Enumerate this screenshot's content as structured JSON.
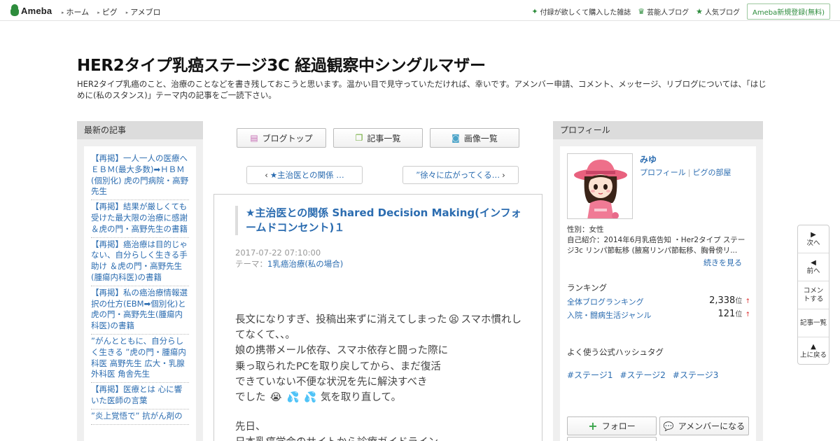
{
  "topbar": {
    "logo": "Ameba",
    "nav": [
      "ホーム",
      "ピグ",
      "アメブロ"
    ],
    "links": [
      {
        "icon": "sparkle-icon",
        "label": "付録が欲しくて購入した雑誌"
      },
      {
        "icon": "crown-icon",
        "label": "芸能人ブログ"
      },
      {
        "icon": "star-icon",
        "label": "人気ブログ"
      }
    ],
    "register": "Ameba新規登録(無料)"
  },
  "header": {
    "title": "HER2タイプ乳癌ステージ3C 経過観察中シングルマザー",
    "description": "HER2タイプ乳癌のこと、治療のことなどを書き残しておこうと思います。温かい目で見守っていただければ、幸いです。アメンバー申請、コメント、メッセージ、リブログについては、「はじめに(私のスタンス)」テーマ内の記事をご一読下さい。"
  },
  "left": {
    "heading": "最新の記事",
    "items": [
      "【再掲】一人一人の医療へ ＥＢＭ(最大多数)➡ＨＢＭ(個別化) 虎の門病院・高野先生",
      "【再掲】結果が厳しくても受けた最大限の治療に感謝 ＆虎の門・高野先生の書籍",
      "【再掲】癌治療は目的じゃない、自分らしく生きる手助け ＆虎の門・高野先生(腫瘍内科医)の書籍",
      "【再掲】私の癌治療情報選択の仕方(EBM➡個別化)と虎の門・高野先生(腫瘍内科医)の書籍",
      "”がんとともに、自分らしく生きる ”虎の門・腫瘍内科医 高野先生 広大・乳腺外科医 角舎先生",
      "【再掲】医療とは 心に響いた医師の言葉",
      "”炎上覚悟で” 抗がん剤の"
    ]
  },
  "nav_buttons": [
    {
      "icon": "document-icon",
      "label": "ブログトップ"
    },
    {
      "icon": "copy-icon",
      "label": "記事一覧"
    },
    {
      "icon": "camera-icon",
      "label": "画像一覧"
    }
  ],
  "pager": {
    "prev": "★主治医との関係 …",
    "next": "”徐々に広がってくる…"
  },
  "article": {
    "title": "★主治医との関係 Shared Decision Making(インフォームドコンセント)１",
    "date": "2017-07-22 07:10:00",
    "theme_label": "テーマ：",
    "theme": "1乳癌治療(私の場合)",
    "line1a": "長文になりすぎ、投稿出来ずに消えてしまった",
    "emoji1": "😫",
    "line1b": "スマホ慣れしてなくて、、。",
    "line2": "娘の携帯メール依存、スマホ依存と闘った際に",
    "line3": "乗っ取られたPCを取り戻してから、まだ復活",
    "line4": "できていない不便な状況を先に解決すべき",
    "line5a": "でした",
    "emoji2": "😭",
    "emoji3": "💦",
    "emoji4": "💦",
    "line5b": "気を取り直して。",
    "line6": "先日、",
    "line7": "日本乳癌学会のサイトから診療ガイドライン"
  },
  "profile": {
    "heading": "プロフィール",
    "name": "みゆ",
    "link1": "プロフィール",
    "link2": "ピグの部屋",
    "gender": "性別：女性",
    "intro": "自己紹介：2014年6月乳癌告知 ・Her2タイプ ステージ3c リンパ節転移 (腋窩リンパ節転移、胸骨傍リ...",
    "more": "続きを見る",
    "ranking_heading": "ランキング",
    "rankings": [
      {
        "label": "全体ブログランキング",
        "value": "2,338",
        "unit": "位",
        "trend": "↑"
      },
      {
        "label": "入院・闘病生活ジャンル",
        "value": "121",
        "unit": "位",
        "trend": "↑"
      }
    ],
    "hashtag_heading": "よく使う公式ハッシュタグ",
    "hashtags": [
      "#ステージ1",
      "#ステージ2",
      "#ステージ3"
    ],
    "follow": "フォロー",
    "amember": "アメンバーになる"
  },
  "side_nav": [
    {
      "icon": "triangle-right-icon",
      "label": "次へ"
    },
    {
      "icon": "triangle-left-icon",
      "label": "前へ"
    },
    {
      "icon": "",
      "label": "コメントする"
    },
    {
      "icon": "",
      "label": "記事一覧"
    },
    {
      "icon": "triangle-up-icon",
      "label": "上に戻る"
    }
  ]
}
